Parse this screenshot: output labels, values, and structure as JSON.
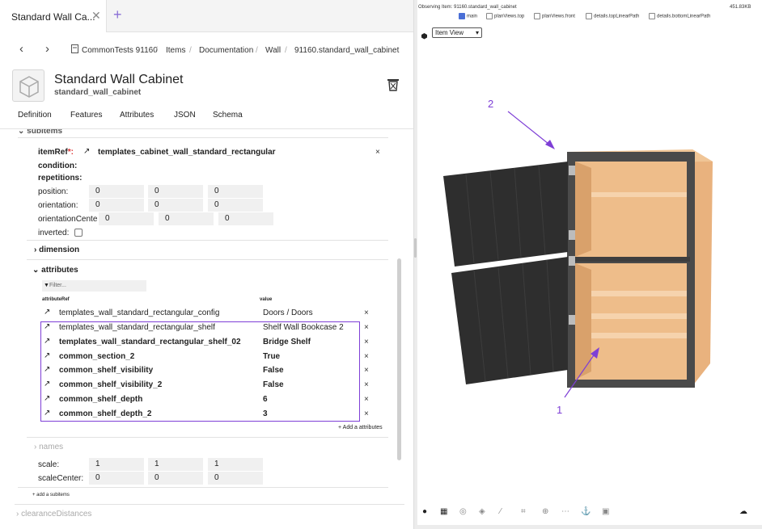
{
  "tabbar": {
    "tab_title": "Standard Wall Ca...",
    "close": "✕",
    "new_tab": "+"
  },
  "breadcrumb": {
    "back": "‹",
    "forward": "›",
    "items": [
      "CommonTests 91160",
      "Items",
      "Documentation",
      "Wall",
      "91160.standard_wall_cabinet"
    ],
    "separator": "/"
  },
  "header": {
    "title": "Standard Wall Cabinet",
    "subtitle": "standard_wall_cabinet"
  },
  "tabs": [
    "Definition",
    "Features",
    "Attributes",
    "JSON",
    "Schema"
  ],
  "subitems": {
    "section_label": "subitems",
    "itemRef_label": "itemRef",
    "itemRef_required": "*:",
    "itemRef_value": "templates_cabinet_wall_standard_rectangular",
    "condition_label": "condition:",
    "repetitions_label": "repetitions:",
    "position_label": "position:",
    "position_values": [
      "0",
      "0",
      "0"
    ],
    "orientation_label": "orientation:",
    "orientation_values": [
      "0",
      "0",
      "0"
    ],
    "orientationCenter_label": "orientationCente",
    "orientationCenter_values": [
      "0",
      "0",
      "0"
    ],
    "inverted_label": "inverted:",
    "dimension_label": "dimension",
    "attributes_label": "attributes",
    "filter_placeholder": "Filter...",
    "col_attributeRef": "attributeRef",
    "col_value": "value",
    "rows": [
      {
        "ref": "templates_wall_standard_rectangular_config",
        "value": "Doors / Doors",
        "bold": false
      },
      {
        "ref": "templates_wall_standard_rectangular_shelf",
        "value": "Shelf Wall Bookcase 2",
        "bold": false
      },
      {
        "ref": "templates_wall_standard_rectangular_shelf_02",
        "value": "Bridge Shelf",
        "bold": true
      },
      {
        "ref": "common_section_2",
        "value": "True",
        "bold": true
      },
      {
        "ref": "common_shelf_visibility",
        "value": "False",
        "bold": true
      },
      {
        "ref": "common_shelf_visibility_2",
        "value": "False",
        "bold": true
      },
      {
        "ref": "common_shelf_depth",
        "value": "6",
        "bold": true
      },
      {
        "ref": "common_shelf_depth_2",
        "value": "3",
        "bold": true
      }
    ],
    "remove": "×",
    "add_attributes": "+ Add a attributes",
    "names_label": "names",
    "scale_label": "scale:",
    "scale_values": [
      "1",
      "1",
      "1"
    ],
    "scaleCenter_label": "scaleCenter:",
    "scaleCenter_values": [
      "0",
      "0",
      "0"
    ],
    "add_subitems": "+ add a subitems",
    "clearance_label": "clearanceDistances"
  },
  "viewer": {
    "observing": "Observing Item: 91160.standard_wall_cabinet",
    "size": "451.83KB",
    "checkboxes": [
      {
        "label": "main",
        "checked": true
      },
      {
        "label": "planViews.top",
        "checked": false
      },
      {
        "label": "planViews.front",
        "checked": false
      },
      {
        "label": "details.topLinearPath",
        "checked": false
      },
      {
        "label": "details.bottomLinearPath",
        "checked": false
      }
    ],
    "view_select": "Item View",
    "annotation_1": "1",
    "annotation_2": "2"
  },
  "colors": {
    "accent": "#7e3fd6",
    "cabinet_wood": "#eebd8a",
    "door": "#2e2e2e"
  }
}
